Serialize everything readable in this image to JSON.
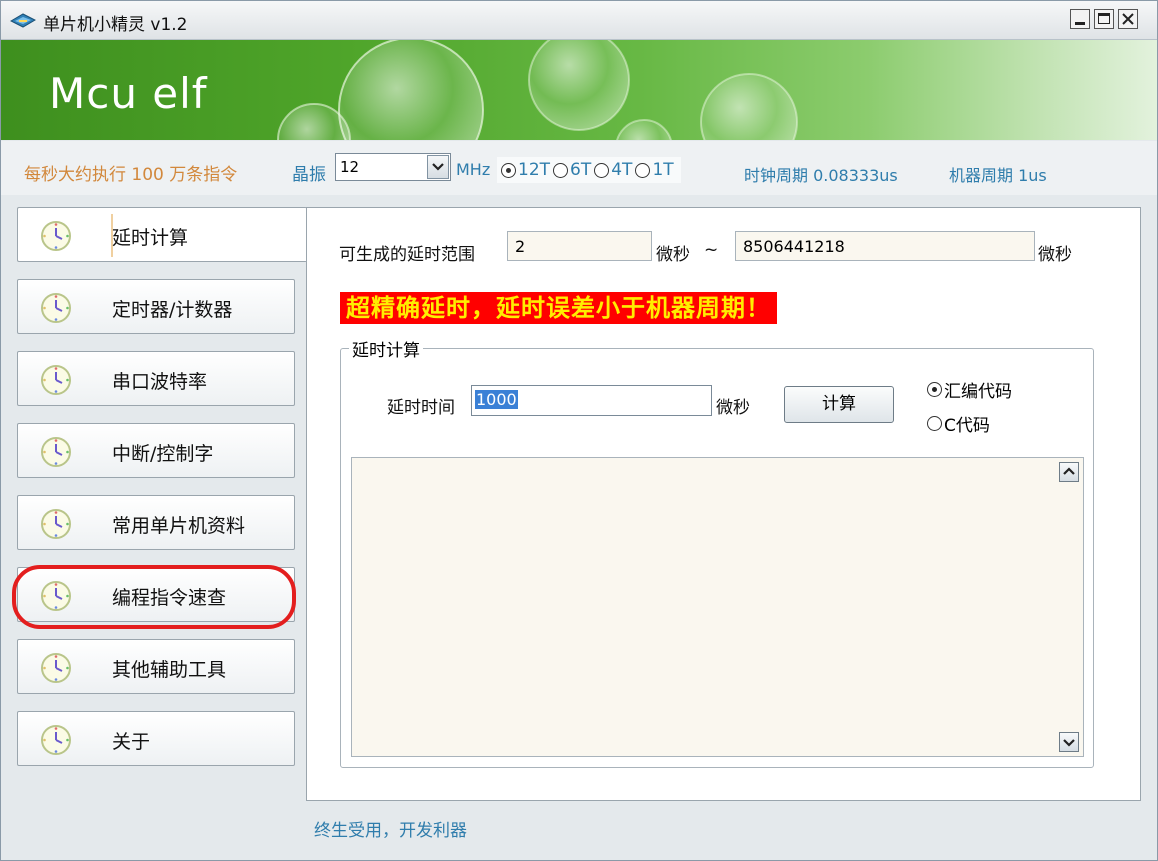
{
  "window": {
    "title": "单片机小精灵 v1.2",
    "logo": "Mcu elf"
  },
  "info": {
    "speed_text": "每秒大约执行 100 万条指令",
    "crystal_label": "晶振",
    "crystal_value": "12",
    "crystal_unit": "MHz",
    "clock_modes": [
      "12T",
      "6T",
      "4T",
      "1T"
    ],
    "selected_mode": "12T",
    "clock_period": "时钟周期 0.08333us",
    "machine_period": "机器周期 1us"
  },
  "nav": {
    "items": [
      {
        "label": "延时计算"
      },
      {
        "label": "定时器/计数器"
      },
      {
        "label": "串口波特率"
      },
      {
        "label": "中断/控制字"
      },
      {
        "label": "常用单片机资料"
      },
      {
        "label": "编程指令速查"
      },
      {
        "label": "其他辅助工具"
      },
      {
        "label": "关于"
      }
    ],
    "active": "延时计算",
    "highlighted": "编程指令速查"
  },
  "main": {
    "range_label": "可生成的延时范围",
    "range_min": "2",
    "unit_us": "微秒",
    "tilde": "~",
    "range_max": "8506441218",
    "notice": "超精确延时，延时误差小于机器周期！",
    "group_title": "延时计算",
    "delay_label": "延时时间",
    "delay_value": "1000",
    "calc_button": "计算",
    "option_asm": "汇编代码",
    "option_c": "C代码",
    "selected_option": "汇编代码",
    "output_text": ""
  },
  "footer": {
    "slogan": "终生受用，开发利器"
  },
  "colors": {
    "accent_text": "#2f7dac",
    "speed_text": "#d2883c",
    "notice_bg": "#ff0000",
    "notice_fg": "#ffee00",
    "highlight_ring": "#e31e1e"
  },
  "icons": {
    "app": "chip-icon",
    "nav": "clock-icon",
    "minimize": "minimize-icon",
    "maximize": "maximize-icon",
    "close": "close-icon",
    "dropdown": "chevron-down-icon",
    "scroll_up": "chevron-up-icon",
    "scroll_down": "chevron-down-icon"
  }
}
